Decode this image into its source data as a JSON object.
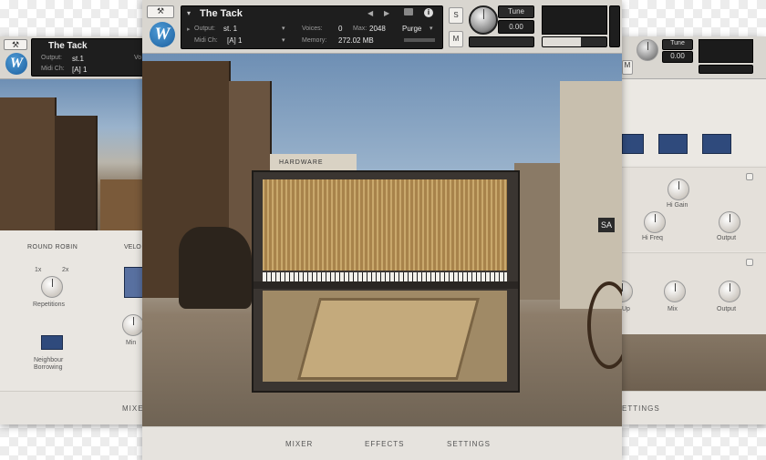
{
  "left": {
    "title": "The Tack",
    "output_label": "Output:",
    "output_value": "st.1",
    "midi_label": "Midi Ch:",
    "midi_value": "[A] 1",
    "voices_abbr": "Vo",
    "round_robin": "ROUND ROBIN",
    "velo": "VELO",
    "opt_1x": "1x",
    "opt_2x": "2x",
    "repetitions": "Repetitions",
    "neighbour": "Neighbour",
    "borrowing": "Borrowing",
    "min": "Min",
    "mixer": "MIXER"
  },
  "center": {
    "title": "The Tack",
    "output_label": "Output:",
    "output_value": "st. 1",
    "midi_label": "Midi Ch:",
    "midi_value": "[A]  1",
    "voices_label": "Voices:",
    "voices_value": "0",
    "max_label": "Max:",
    "max_value": "2048",
    "memory_label": "Memory:",
    "memory_value": "272.02 MB",
    "purge": "Purge",
    "tune_label": "Tune",
    "tune_value": "0.00",
    "s_btn": "S",
    "m_btn": "M",
    "sign_hardware": "HARDWARE",
    "sign_saloon": "SA",
    "tabs": [
      "MIXER",
      "EFFECTS",
      "SETTINGS"
    ]
  },
  "right": {
    "tune_label": "Tune",
    "tune_value": "0.00",
    "hi_gain": "Hi Gain",
    "hi_freq": "Hi Freq",
    "output1": "Output",
    "up": "Up",
    "mix": "Mix",
    "output2": "Output",
    "settings": "ETTINGS"
  }
}
